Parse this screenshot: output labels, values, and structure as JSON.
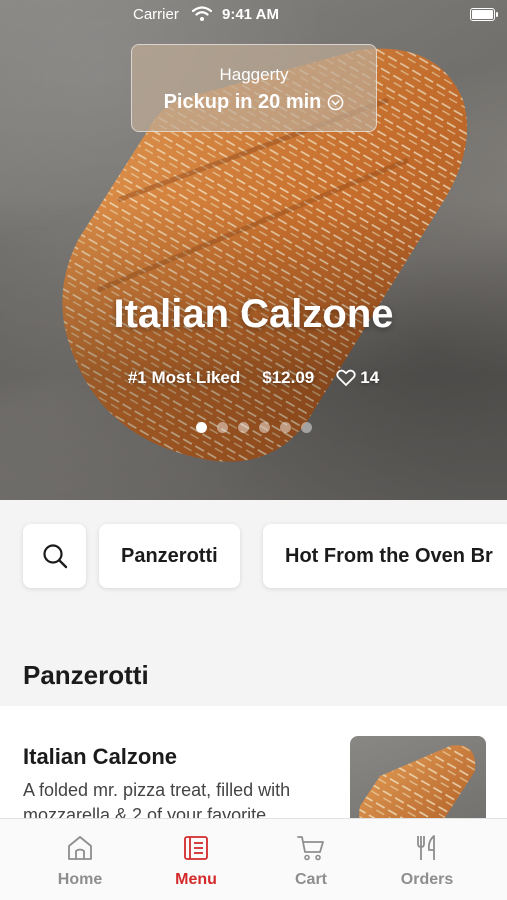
{
  "status_bar": {
    "carrier": "Carrier",
    "time": "9:41 AM"
  },
  "pickup": {
    "store": "Haggerty",
    "eta": "Pickup in 20 min"
  },
  "hero": {
    "title": "Italian Calzone",
    "rank": "#1 Most Liked",
    "price": "$12.09",
    "likes": "14",
    "carousel": {
      "total": 6,
      "active": 1
    }
  },
  "categories": {
    "items": [
      "Panzerotti",
      "Hot From the Oven Br"
    ]
  },
  "section": {
    "title": "Panzerotti"
  },
  "menu_item": {
    "name": "Italian Calzone",
    "description": "A folded mr. pizza treat, filled with mozzarella & 2 of your favorite..."
  },
  "tabs": [
    {
      "label": "Home",
      "icon": "home-icon"
    },
    {
      "label": "Menu",
      "icon": "menu-icon"
    },
    {
      "label": "Cart",
      "icon": "cart-icon"
    },
    {
      "label": "Orders",
      "icon": "orders-icon"
    }
  ],
  "colors": {
    "accent": "#d42a2a",
    "inactive": "#8e8e8e"
  }
}
